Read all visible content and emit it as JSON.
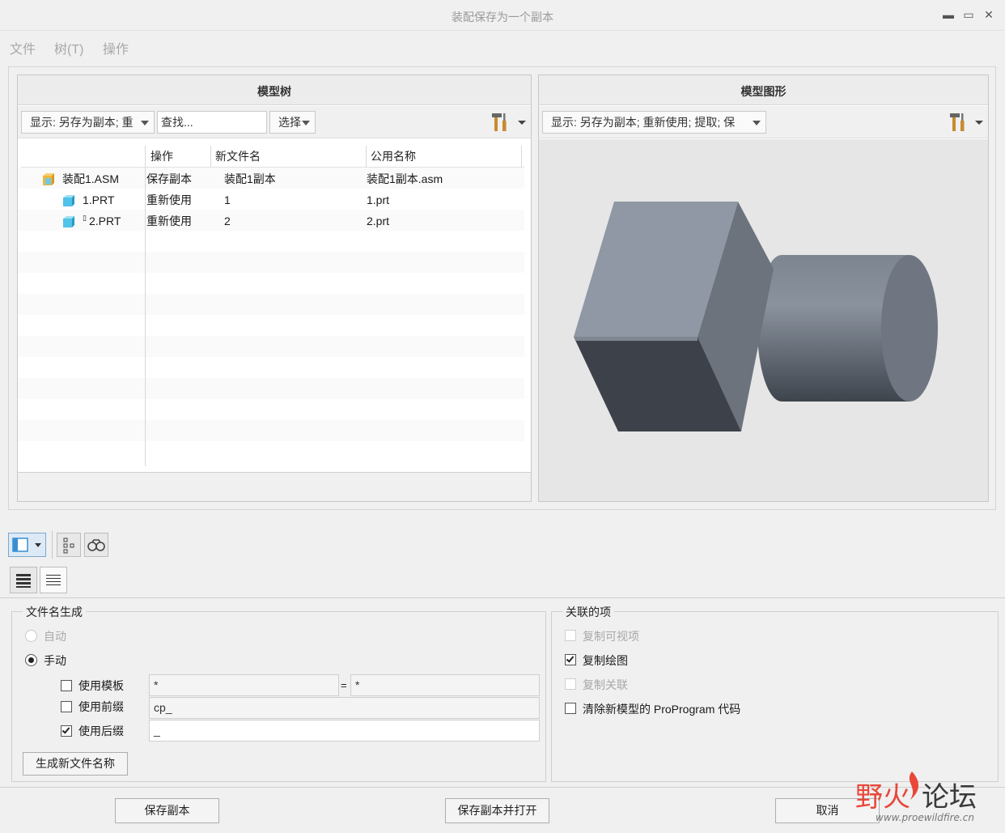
{
  "window": {
    "title": "装配保存为一个副本",
    "controls": {
      "minimize": "▬",
      "maximize": "▭",
      "close": "✕"
    }
  },
  "menubar": {
    "items": [
      "文件",
      "树(T)",
      "操作"
    ]
  },
  "model_tree": {
    "header": "模型树",
    "display_dropdown": "显示: 另存为副本; 重",
    "search_placeholder": "查找...",
    "select_dropdown": "选择",
    "columns": [
      "操作",
      "新文件名",
      "公用名称"
    ],
    "rows": [
      {
        "name": "装配1.ASM",
        "operation": "保存副本",
        "new_name": "装配1副本",
        "common_name": "装配1副本.asm",
        "icon": "assembly-icon"
      },
      {
        "name": "1.PRT",
        "operation": "重新使用",
        "new_name": "1",
        "common_name": "1.prt",
        "icon": "part-icon"
      },
      {
        "name": "2.PRT",
        "operation": "重新使用",
        "new_name": "2",
        "common_name": "2.prt",
        "icon": "part-icon"
      }
    ]
  },
  "model_graphics": {
    "header": "模型图形",
    "display_dropdown": "显示: 另存为副本; 重新使用; 提取; 保"
  },
  "filename_generation": {
    "legend": "文件名生成",
    "auto_label": "自动",
    "manual_label": "手动",
    "use_template_label": "使用模板",
    "use_prefix_label": "使用前缀",
    "use_suffix_label": "使用后缀",
    "template_left": "*",
    "equals": "=",
    "template_right": "*",
    "prefix_value": "cp_",
    "suffix_value": "_",
    "generate_button": "生成新文件名称"
  },
  "related_items": {
    "legend": "关联的项",
    "copy_visible": "复制可视项",
    "copy_drawing": "复制绘图",
    "copy_relations": "复制关联",
    "clear_proprogram": "清除新模型的 ProProgram 代码"
  },
  "buttons": {
    "save_copy": "保存副本",
    "save_copy_open": "保存副本并打开",
    "cancel": "取消"
  },
  "watermark": {
    "brand": "野火论坛",
    "url": "www.proewildfire.cn"
  },
  "colors": {
    "accent": "#3b8fd1",
    "part_icon": "#4fc3e8",
    "assembly_icon": "#f0b63a",
    "watermark": "#e8483a"
  }
}
